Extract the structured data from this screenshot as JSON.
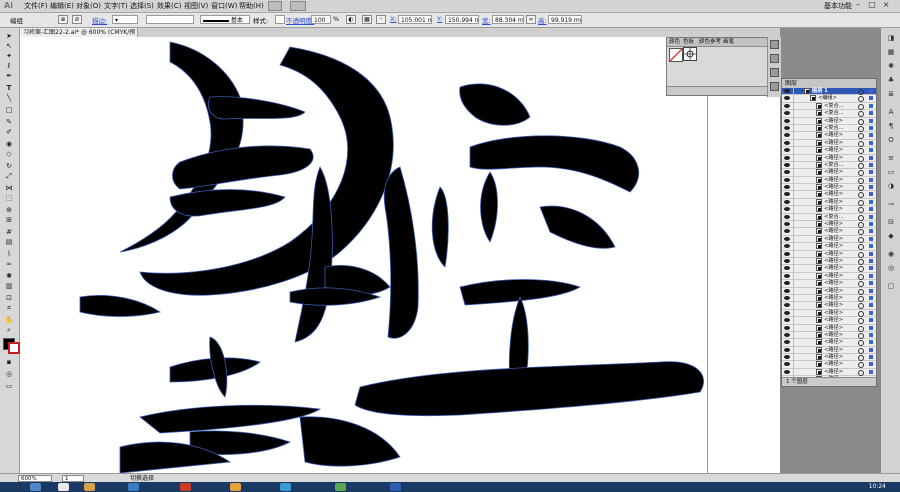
{
  "app": {
    "logo": "Ai"
  },
  "menu": [
    "文件(F)",
    "编辑(E)",
    "对象(O)",
    "文字(T)",
    "选择(S)",
    "效果(C)",
    "视图(V)",
    "窗口(W)",
    "帮助(H)"
  ],
  "workspace": "基本功能",
  "window_controls": [
    "–",
    "□",
    "×"
  ],
  "control_bar": {
    "selection": "编组",
    "stroke_label": "描边:",
    "stroke_style": "基本",
    "style_label": "样式:",
    "opacity_label": "不透明度:",
    "opacity_value": "100",
    "opacity_unit": "%",
    "x_label": "X:",
    "x_value": "105.001 mm",
    "y_label": "Y:",
    "y_value": "150.994 mm",
    "w_label": "宽:",
    "w_value": "88.304 mm",
    "h_label": "高:",
    "h_value": "99.919 mm"
  },
  "document_tab": "习岭案-汇图22-2.ai* @ 600% (CMYK/预览)",
  "color_panel": {
    "tabs": [
      "颜色",
      "色板",
      "颜色参考",
      "画笔"
    ]
  },
  "layers": {
    "tabs": [
      "图层"
    ],
    "rows": [
      {
        "name": "图层 1",
        "kind": "layer"
      },
      {
        "name": "<编组>",
        "kind": "group"
      },
      {
        "name": "<复合...",
        "kind": "item"
      },
      {
        "name": "<复合...",
        "kind": "item"
      },
      {
        "name": "<路径>",
        "kind": "item"
      },
      {
        "name": "<复合...",
        "kind": "item"
      },
      {
        "name": "<路径>",
        "kind": "item"
      },
      {
        "name": "<路径>",
        "kind": "item"
      },
      {
        "name": "<路径>",
        "kind": "item"
      },
      {
        "name": "<路径>",
        "kind": "item"
      },
      {
        "name": "<复合...",
        "kind": "item"
      },
      {
        "name": "<路径>",
        "kind": "item"
      },
      {
        "name": "<路径>",
        "kind": "item"
      },
      {
        "name": "<路径>",
        "kind": "item"
      },
      {
        "name": "<路径>",
        "kind": "item"
      },
      {
        "name": "<路径>",
        "kind": "item"
      },
      {
        "name": "<路径>",
        "kind": "item"
      },
      {
        "name": "<复合...",
        "kind": "item"
      },
      {
        "name": "<路径>",
        "kind": "item"
      },
      {
        "name": "<路径>",
        "kind": "item"
      },
      {
        "name": "<路径>",
        "kind": "item"
      },
      {
        "name": "<路径>",
        "kind": "item"
      },
      {
        "name": "<路径>",
        "kind": "item"
      },
      {
        "name": "<路径>",
        "kind": "item"
      },
      {
        "name": "<路径>",
        "kind": "item"
      },
      {
        "name": "<路径>",
        "kind": "item"
      },
      {
        "name": "<路径>",
        "kind": "item"
      },
      {
        "name": "<路径>",
        "kind": "item"
      },
      {
        "name": "<路径>",
        "kind": "item"
      },
      {
        "name": "<路径>",
        "kind": "item"
      },
      {
        "name": "<路径>",
        "kind": "item"
      },
      {
        "name": "<路径>",
        "kind": "item"
      },
      {
        "name": "<路径>",
        "kind": "item"
      },
      {
        "name": "<路径>",
        "kind": "item"
      },
      {
        "name": "<路径>",
        "kind": "item"
      },
      {
        "name": "<路径>",
        "kind": "item"
      },
      {
        "name": "<路径>",
        "kind": "item"
      },
      {
        "name": "<路径>",
        "kind": "item"
      },
      {
        "name": "<路径>",
        "kind": "item"
      },
      {
        "name": "<路径>",
        "kind": "item"
      }
    ],
    "footer": "1 个图层"
  },
  "status": {
    "zoom": "600%",
    "page": "1",
    "text": "切换选择"
  },
  "clock": "10:24",
  "colors": {
    "accent": "#2e57b8",
    "guide": "#7a9bd0",
    "ink": "#000000"
  }
}
